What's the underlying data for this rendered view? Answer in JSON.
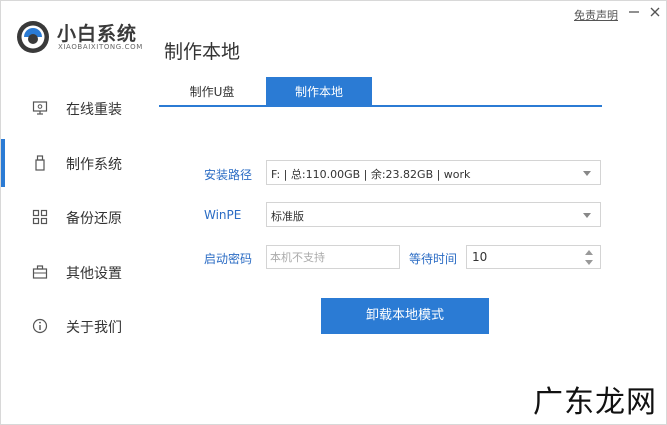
{
  "brand": {
    "name": "小白系统",
    "subtitle": "XIAOBAIXITONG.COM"
  },
  "header": {
    "title": "制作本地",
    "disclaimer": "免责声明"
  },
  "sidebar": {
    "items": [
      {
        "label": "在线重装",
        "icon": "monitor-icon"
      },
      {
        "label": "制作系统",
        "icon": "usb-drive-icon"
      },
      {
        "label": "备份还原",
        "icon": "grid-icon"
      },
      {
        "label": "其他设置",
        "icon": "briefcase-icon"
      },
      {
        "label": "关于我们",
        "icon": "info-icon"
      }
    ],
    "active_index": 1
  },
  "tabs": [
    {
      "label": "制作U盘"
    },
    {
      "label": "制作本地"
    }
  ],
  "form": {
    "install_path": {
      "label": "安装路径",
      "value": "F: | 总:110.00GB | 余:23.82GB | work"
    },
    "winpe": {
      "label": "WinPE",
      "value": "标准版"
    },
    "boot_password": {
      "label": "启动密码",
      "placeholder": "本机不支持"
    },
    "wait_time": {
      "label": "等待时间",
      "value": "10"
    }
  },
  "actions": {
    "primary_label": "卸载本地模式"
  },
  "watermark": "广东龙网",
  "colors": {
    "accent": "#2b7bd4",
    "label": "#2b6cc4"
  }
}
